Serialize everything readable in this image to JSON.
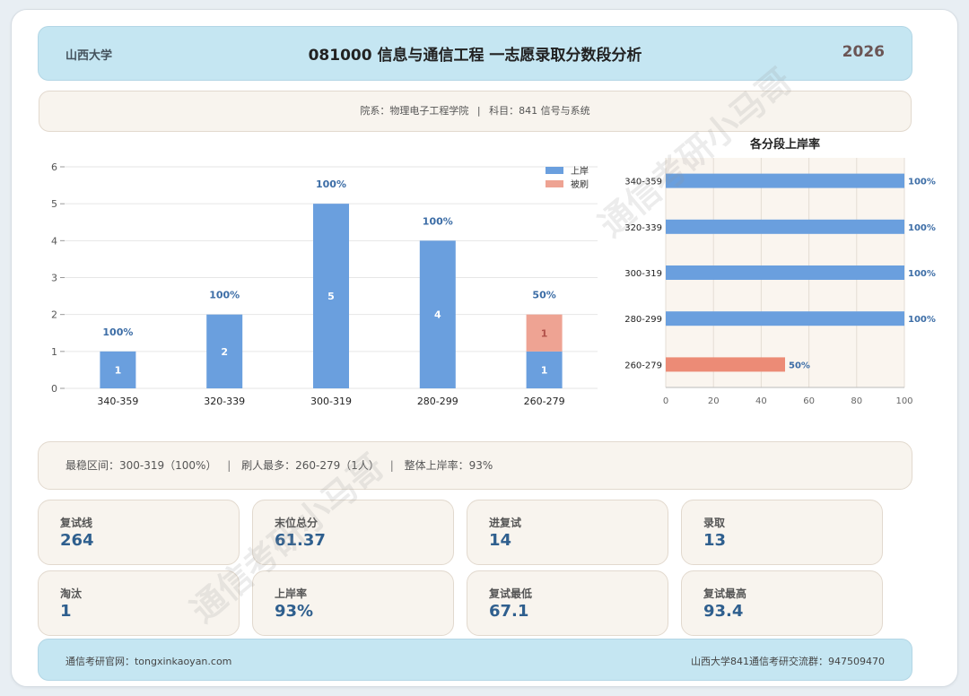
{
  "header": {
    "school": "山西大学",
    "title": "081000 信息与通信工程 一志愿录取分数段分析",
    "year": "2026"
  },
  "subinfo": {
    "dept": "院系：物理电子工程学院",
    "divider": "|",
    "subject": "科目：841 信号与系统"
  },
  "chart_data": [
    {
      "type": "bar",
      "stacked": true,
      "categories": [
        "340-359",
        "320-339",
        "300-319",
        "280-299",
        "260-279"
      ],
      "series": [
        {
          "name": "上岸",
          "values": [
            1,
            2,
            5,
            4,
            1
          ],
          "color": "#6a9fde"
        },
        {
          "name": "被刷",
          "values": [
            0,
            0,
            0,
            0,
            1
          ],
          "color": "#eea393"
        }
      ],
      "rate_labels": [
        "100%",
        "100%",
        "100%",
        "100%",
        "50%"
      ],
      "ylim": [
        0,
        6
      ],
      "yticks": [
        "0",
        "1",
        "2",
        "3",
        "4",
        "5",
        "6"
      ],
      "grid": true,
      "legend": "top-right",
      "title": "",
      "xlabel": "",
      "ylabel": ""
    },
    {
      "type": "bar",
      "orientation": "horizontal",
      "title": "各分段上岸率",
      "categories": [
        "340-359",
        "320-339",
        "300-319",
        "280-299",
        "260-279"
      ],
      "values": [
        100,
        100,
        100,
        100,
        50
      ],
      "value_labels": [
        "100%",
        "100%",
        "100%",
        "100%",
        "50%"
      ],
      "colors": [
        "#6a9fde",
        "#6a9fde",
        "#6a9fde",
        "#6a9fde",
        "#ec8b76"
      ],
      "xlim": [
        0,
        100
      ],
      "xticks": [
        "0",
        "20",
        "40",
        "60",
        "80",
        "100"
      ],
      "grid": true
    }
  ],
  "summary": {
    "stable": "最稳区间：300-319（100%）",
    "most_cut": "刷人最多：260-279（1人）",
    "overall": "整体上岸率：93%",
    "sep": "|"
  },
  "stats": [
    {
      "label": "复试线",
      "value": "264"
    },
    {
      "label": "末位总分",
      "value": "61.37"
    },
    {
      "label": "进复试",
      "value": "14"
    },
    {
      "label": "录取",
      "value": "13"
    },
    {
      "label": "淘汰",
      "value": "1"
    },
    {
      "label": "上岸率",
      "value": "93%"
    },
    {
      "label": "复试最低",
      "value": "67.1"
    },
    {
      "label": "复试最高",
      "value": "93.4"
    }
  ],
  "footer": {
    "website": "通信考研官网：tongxinkaoyan.com",
    "group": "山西大学841通信考研交流群：947509470"
  },
  "watermark": "通信考研小马哥"
}
